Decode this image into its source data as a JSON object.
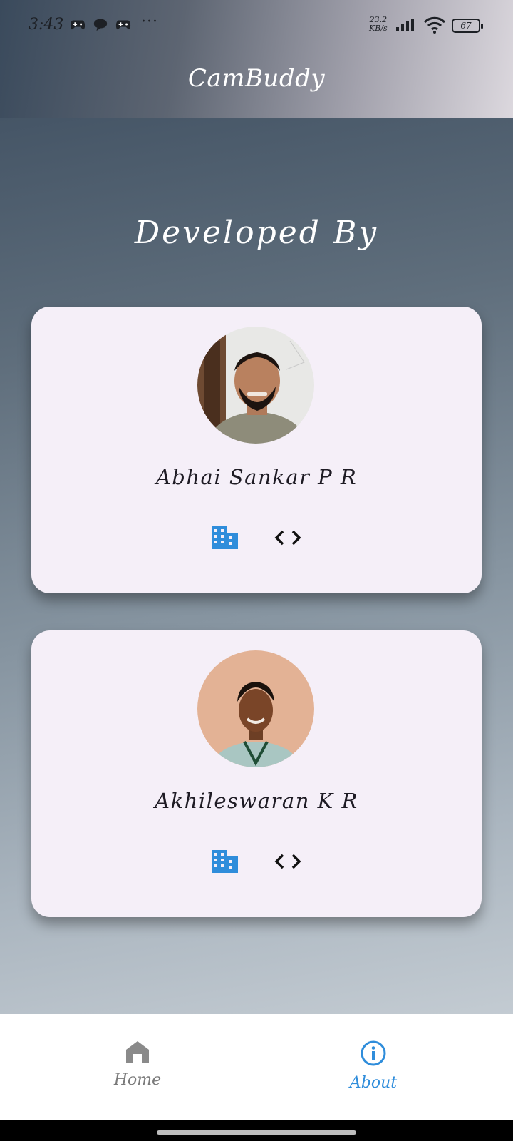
{
  "status_bar": {
    "time": "3:43",
    "net_speed_value": "23.2",
    "net_speed_unit": "KB/s",
    "battery": "67",
    "more": "···"
  },
  "app_bar": {
    "title": "CamBuddy"
  },
  "main": {
    "heading": "Developed By",
    "developers": [
      {
        "name": "Abhai Sankar P R",
        "icons": [
          "building-icon",
          "code-icon"
        ]
      },
      {
        "name": "Akhileswaran K R",
        "icons": [
          "building-icon",
          "code-icon"
        ]
      }
    ]
  },
  "bottom_nav": {
    "items": [
      {
        "label": "Home",
        "icon": "home-icon",
        "active": false
      },
      {
        "label": "About",
        "icon": "info-icon",
        "active": true
      }
    ],
    "active_color": "#2f8ddb",
    "inactive_color": "#7a7a7a"
  },
  "colors": {
    "card": "#f5eff8",
    "accent": "#2f8ddb"
  }
}
